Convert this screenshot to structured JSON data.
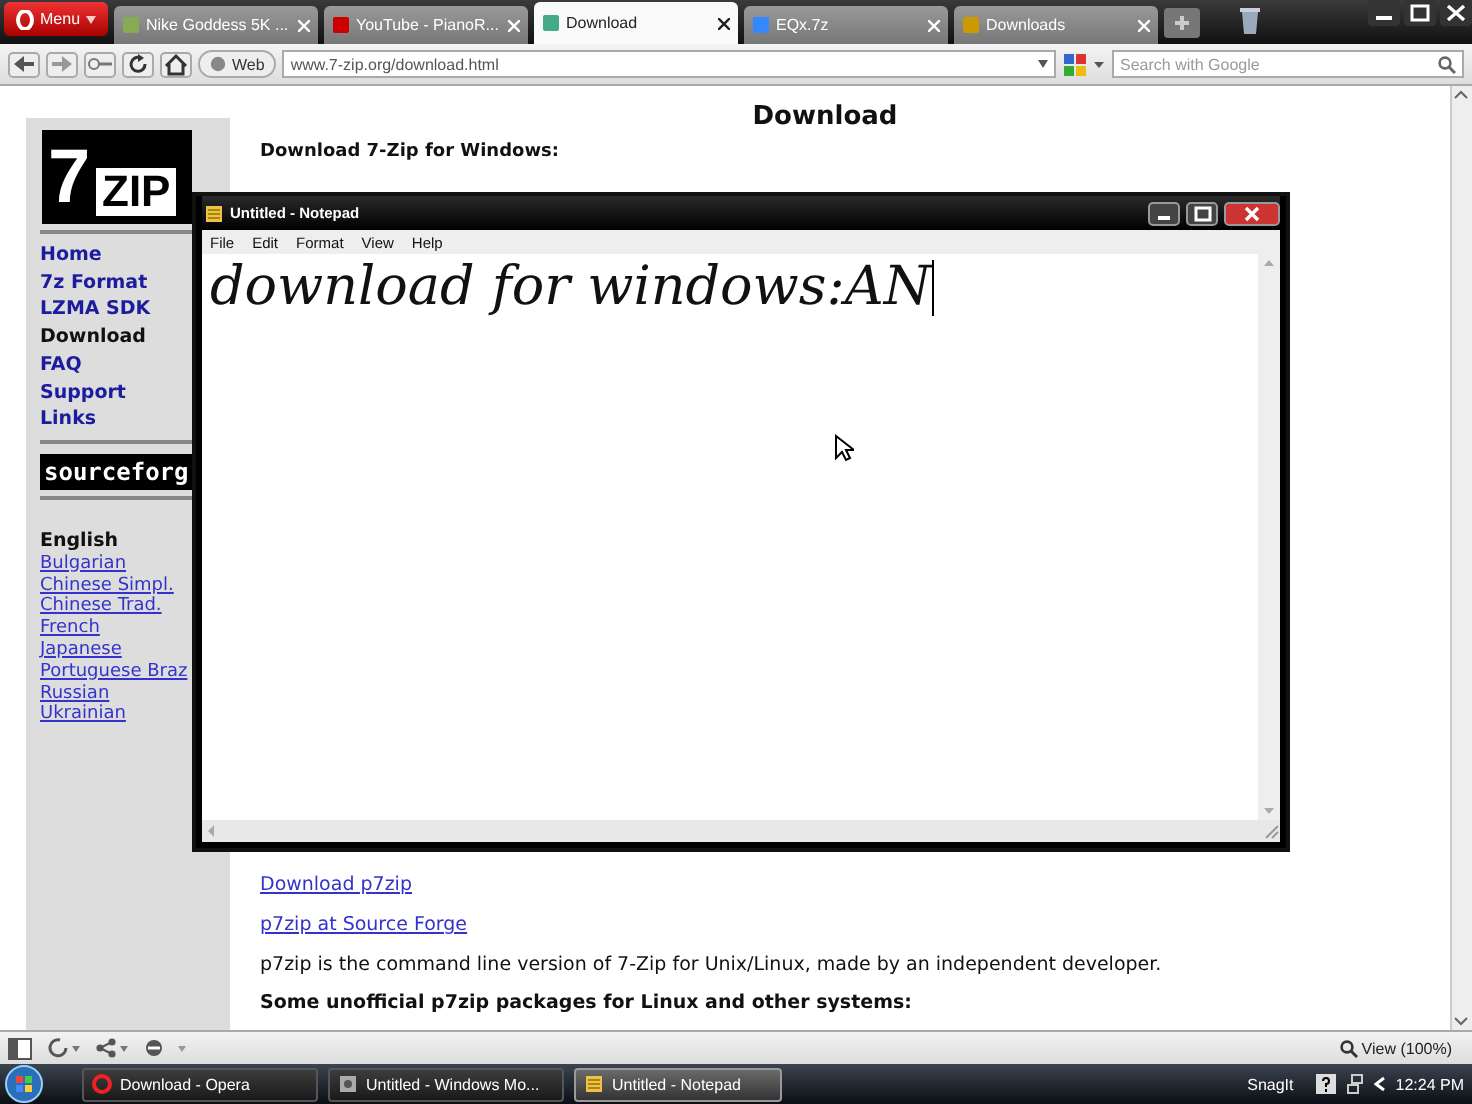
{
  "browser": {
    "menu_button": "Menu",
    "tabs": [
      {
        "label": "Nike Goddess 5K ...",
        "selected": false
      },
      {
        "label": "YouTube - PianoR...",
        "selected": false
      },
      {
        "label": "Download",
        "selected": true
      },
      {
        "label": "EQx.7z",
        "selected": false
      },
      {
        "label": "Downloads",
        "selected": false
      }
    ],
    "address_bar": {
      "search_engine": "Web",
      "url": "www.7-zip.org/download.html"
    },
    "search": {
      "placeholder": "Search with Google"
    }
  },
  "page": {
    "title": "Download",
    "logo": {
      "digit": "7",
      "word": "ZIP"
    },
    "sidebar": {
      "nav": [
        {
          "label": "Home",
          "selected": false
        },
        {
          "label": "7z Format",
          "selected": false
        },
        {
          "label": "LZMA SDK",
          "selected": false
        },
        {
          "label": "Download",
          "selected": true
        },
        {
          "label": "FAQ",
          "selected": false
        },
        {
          "label": "Support",
          "selected": false
        },
        {
          "label": "Links",
          "selected": false
        }
      ],
      "banner": "sourceforg",
      "languages": [
        {
          "label": "English",
          "selected": true
        },
        {
          "label": "Bulgarian",
          "selected": false
        },
        {
          "label": "Chinese Simpl.",
          "selected": false
        },
        {
          "label": "Chinese Trad.",
          "selected": false
        },
        {
          "label": "French",
          "selected": false
        },
        {
          "label": "Japanese",
          "selected": false
        },
        {
          "label": "Portuguese Braz",
          "selected": false
        },
        {
          "label": "Russian",
          "selected": false
        },
        {
          "label": "Ukrainian",
          "selected": false
        }
      ]
    },
    "section_heading": "Download 7-Zip for Windows:",
    "links": [
      "Download p7zip",
      "p7zip at Source Forge"
    ],
    "description": "p7zip is the command line version of 7-Zip for Unix/Linux, made by an independent developer.",
    "subheading": "Some unofficial p7zip packages for Linux and other systems:"
  },
  "notepad": {
    "title": "Untitled - Notepad",
    "menu": [
      "File",
      "Edit",
      "Format",
      "View",
      "Help"
    ],
    "content": "download for windows:AN"
  },
  "status_bar": {
    "zoom": "View (100%)"
  },
  "taskbar": {
    "items": [
      {
        "label": "Download - Opera",
        "selected": false
      },
      {
        "label": "Untitled - Windows Mo...",
        "selected": false
      },
      {
        "label": "Untitled - Notepad",
        "selected": true
      }
    ],
    "tray_app": "SnagIt",
    "clock": "12:24 PM"
  }
}
